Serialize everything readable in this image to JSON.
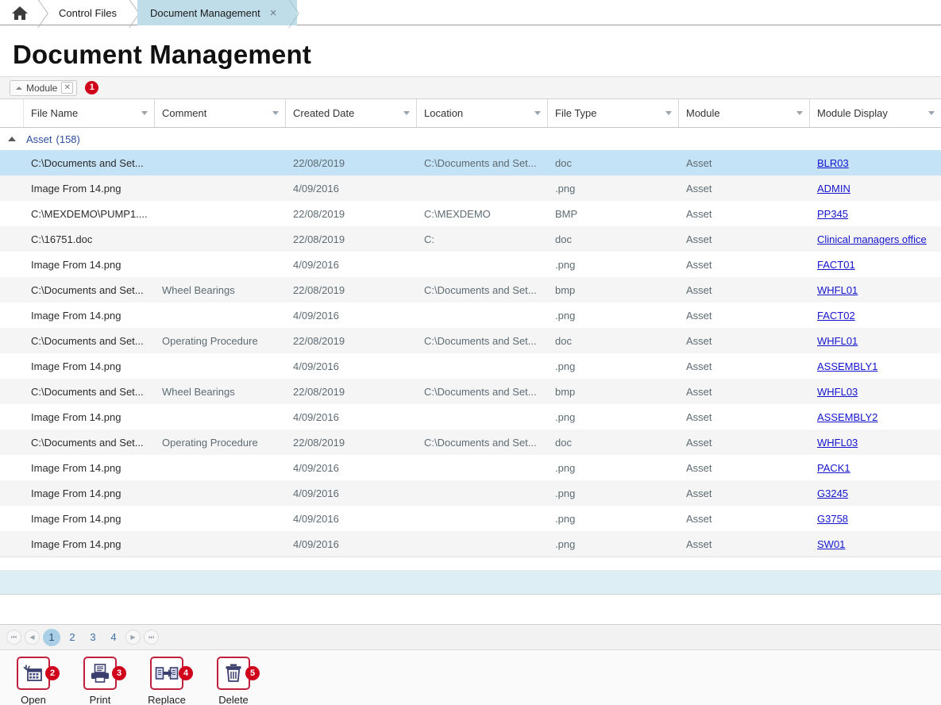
{
  "breadcrumbs": [
    {
      "label": "",
      "icon": "home-icon",
      "active": false
    },
    {
      "label": "Control Files",
      "active": false
    },
    {
      "label": "Document Management",
      "active": true,
      "close": "×"
    }
  ],
  "header": {
    "title": "Document Management"
  },
  "group_bar": {
    "chip_label": "Module",
    "chip_close": "✕",
    "badge": "1"
  },
  "grid": {
    "columns": [
      {
        "key": "file_name",
        "label": "File Name"
      },
      {
        "key": "comment",
        "label": "Comment"
      },
      {
        "key": "created_date",
        "label": "Created Date"
      },
      {
        "key": "location",
        "label": "Location"
      },
      {
        "key": "file_type",
        "label": "File Type"
      },
      {
        "key": "module",
        "label": "Module"
      },
      {
        "key": "module_display",
        "label": "Module Display"
      }
    ],
    "group": {
      "label": "Asset",
      "count": "(158)"
    },
    "rows": [
      {
        "file_name": "C:\\Documents and Set...",
        "comment": "",
        "created_date": "22/08/2019",
        "location": "C:\\Documents and Set...",
        "file_type": "doc",
        "module": "Asset",
        "module_display": "BLR03",
        "selected": true
      },
      {
        "file_name": "Image From 14.png",
        "comment": "",
        "created_date": "4/09/2016",
        "location": "",
        "file_type": ".png",
        "module": "Asset",
        "module_display": "ADMIN",
        "selected": false
      },
      {
        "file_name": "C:\\MEXDEMO\\PUMP1....",
        "comment": "",
        "created_date": "22/08/2019",
        "location": "C:\\MEXDEMO",
        "file_type": "BMP",
        "module": "Asset",
        "module_display": "PP345",
        "selected": false
      },
      {
        "file_name": "C:\\16751.doc",
        "comment": "",
        "created_date": "22/08/2019",
        "location": "C:",
        "file_type": "doc",
        "module": "Asset",
        "module_display": "Clinical managers office",
        "selected": false
      },
      {
        "file_name": "Image From 14.png",
        "comment": "",
        "created_date": "4/09/2016",
        "location": "",
        "file_type": ".png",
        "module": "Asset",
        "module_display": "FACT01",
        "selected": false
      },
      {
        "file_name": "C:\\Documents and Set...",
        "comment": "Wheel Bearings",
        "created_date": "22/08/2019",
        "location": "C:\\Documents and Set...",
        "file_type": "bmp",
        "module": "Asset",
        "module_display": "WHFL01",
        "selected": false
      },
      {
        "file_name": "Image From 14.png",
        "comment": "",
        "created_date": "4/09/2016",
        "location": "",
        "file_type": ".png",
        "module": "Asset",
        "module_display": "FACT02",
        "selected": false
      },
      {
        "file_name": "C:\\Documents and Set...",
        "comment": "Operating Procedure",
        "created_date": "22/08/2019",
        "location": "C:\\Documents and Set...",
        "file_type": "doc",
        "module": "Asset",
        "module_display": "WHFL01",
        "selected": false
      },
      {
        "file_name": "Image From 14.png",
        "comment": "",
        "created_date": "4/09/2016",
        "location": "",
        "file_type": ".png",
        "module": "Asset",
        "module_display": "ASSEMBLY1",
        "selected": false
      },
      {
        "file_name": "C:\\Documents and Set...",
        "comment": "Wheel Bearings",
        "created_date": "22/08/2019",
        "location": "C:\\Documents and Set...",
        "file_type": "bmp",
        "module": "Asset",
        "module_display": "WHFL03",
        "selected": false
      },
      {
        "file_name": "Image From 14.png",
        "comment": "",
        "created_date": "4/09/2016",
        "location": "",
        "file_type": ".png",
        "module": "Asset",
        "module_display": "ASSEMBLY2",
        "selected": false
      },
      {
        "file_name": "C:\\Documents and Set...",
        "comment": "Operating Procedure",
        "created_date": "22/08/2019",
        "location": "C:\\Documents and Set...",
        "file_type": "doc",
        "module": "Asset",
        "module_display": "WHFL03",
        "selected": false
      },
      {
        "file_name": "Image From 14.png",
        "comment": "",
        "created_date": "4/09/2016",
        "location": "",
        "file_type": ".png",
        "module": "Asset",
        "module_display": "PACK1",
        "selected": false
      },
      {
        "file_name": "Image From 14.png",
        "comment": "",
        "created_date": "4/09/2016",
        "location": "",
        "file_type": ".png",
        "module": "Asset",
        "module_display": "G3245",
        "selected": false
      },
      {
        "file_name": "Image From 14.png",
        "comment": "",
        "created_date": "4/09/2016",
        "location": "",
        "file_type": ".png",
        "module": "Asset",
        "module_display": "G3758",
        "selected": false
      },
      {
        "file_name": "Image From 14.png",
        "comment": "",
        "created_date": "4/09/2016",
        "location": "",
        "file_type": ".png",
        "module": "Asset",
        "module_display": "SW01",
        "selected": false
      }
    ]
  },
  "pager": {
    "first": "❘◀",
    "prev": "◀",
    "pages": [
      "1",
      "2",
      "3",
      "4"
    ],
    "current_page": "1",
    "next": "▶",
    "last": "▶❘"
  },
  "actions": [
    {
      "label": "Open",
      "icon": "open-grid-icon",
      "badge": "2"
    },
    {
      "label": "Print",
      "icon": "printer-icon",
      "badge": "3"
    },
    {
      "label": "Replace",
      "icon": "replace-arrow-icon",
      "badge": "4"
    },
    {
      "label": "Delete",
      "icon": "trash-icon",
      "badge": "5"
    }
  ],
  "colors": {
    "accent_red": "#d0021b",
    "selected_row": "#c5e3f6",
    "active_tab": "#bfdde8",
    "link": "#1414cf",
    "summary_band": "#ddeef4"
  }
}
